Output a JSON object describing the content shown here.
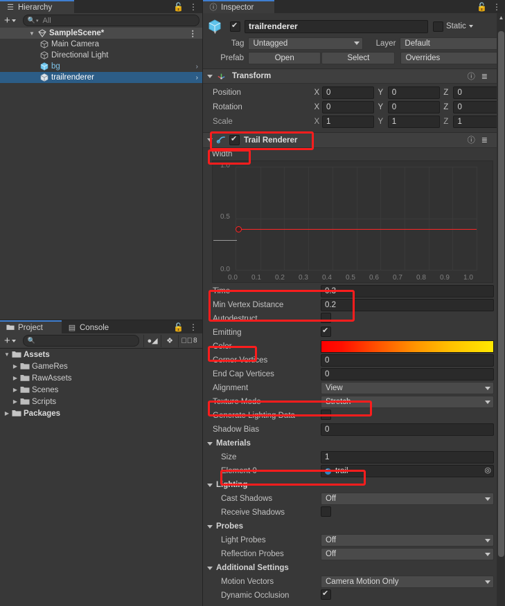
{
  "hierarchy": {
    "tab": "Hierarchy",
    "tab_icon": "hierarchy-icon",
    "lock_icon": "lock-icon",
    "menu_icon": "kebab-menu-icon",
    "add_label": "+",
    "search_placeholder": "All",
    "items": [
      {
        "label": "SampleScene*",
        "depth": 0,
        "icon": "scene-icon",
        "selected": false,
        "scene": true,
        "expanded": true,
        "prefab": false,
        "chevron": false
      },
      {
        "label": "Main Camera",
        "depth": 1,
        "icon": "gameobject-icon",
        "selected": false,
        "scene": false,
        "expanded": false,
        "prefab": false,
        "chevron": false
      },
      {
        "label": "Directional Light",
        "depth": 1,
        "icon": "gameobject-icon",
        "selected": false,
        "scene": false,
        "expanded": false,
        "prefab": false,
        "chevron": false
      },
      {
        "label": "bg",
        "depth": 1,
        "icon": "prefab-icon",
        "selected": false,
        "scene": false,
        "expanded": false,
        "prefab": true,
        "chevron": true
      },
      {
        "label": "trailrenderer",
        "depth": 1,
        "icon": "prefab-icon",
        "selected": true,
        "scene": false,
        "expanded": false,
        "prefab": true,
        "chevron": true
      }
    ]
  },
  "project": {
    "tabs": [
      {
        "label": "Project",
        "icon": "folder-icon",
        "active": true
      },
      {
        "label": "Console",
        "icon": "console-icon",
        "active": false
      }
    ],
    "lock_icon": "lock-icon",
    "menu_icon": "kebab-menu-icon",
    "add_label": "+",
    "search_placeholder": "",
    "toolbar_icons": [
      "avatar-filter-icon",
      "label-filter-icon",
      "visibility-icon"
    ],
    "visibility_count": "8",
    "tree": [
      {
        "label": "Assets",
        "depth": 0,
        "expanded": true,
        "bold": true
      },
      {
        "label": "GameRes",
        "depth": 1,
        "expanded": false,
        "bold": false
      },
      {
        "label": "RawAssets",
        "depth": 1,
        "expanded": false,
        "bold": false
      },
      {
        "label": "Scenes",
        "depth": 1,
        "expanded": false,
        "bold": false
      },
      {
        "label": "Scripts",
        "depth": 1,
        "expanded": false,
        "bold": false
      },
      {
        "label": "Packages",
        "depth": 0,
        "expanded": false,
        "bold": true
      }
    ]
  },
  "inspector": {
    "tab": "Inspector",
    "tab_icon": "info-icon",
    "lock_icon": "lock-icon",
    "menu_icon": "kebab-menu-icon",
    "gameobject": {
      "enabled": true,
      "name": "trailrenderer",
      "static_checked": false,
      "static_label": "Static",
      "tag_label": "Tag",
      "tag_value": "Untagged",
      "layer_label": "Layer",
      "layer_value": "Default",
      "prefab_label": "Prefab",
      "open_label": "Open",
      "select_label": "Select",
      "overrides_label": "Overrides"
    },
    "transform": {
      "title": "Transform",
      "icon": "transform-icon",
      "help_icon": "help-icon",
      "preset_icon": "preset-icon",
      "menu_icon": "kebab-menu-icon",
      "rows": [
        {
          "label": "Position",
          "x": "0",
          "y": "0",
          "z": "0"
        },
        {
          "label": "Rotation",
          "x": "0",
          "y": "0",
          "z": "0"
        },
        {
          "label": "Scale",
          "x": "1",
          "y": "1",
          "z": "1"
        }
      ],
      "axis_labels": [
        "X",
        "Y",
        "Z"
      ]
    },
    "trail_renderer": {
      "title": "Trail Renderer",
      "icon": "trail-renderer-icon",
      "enabled": true,
      "help_icon": "help-icon",
      "preset_icon": "preset-icon",
      "menu_icon": "kebab-menu-icon",
      "width_label": "Width",
      "properties": [
        {
          "label": "Time",
          "type": "text",
          "value": "0.3"
        },
        {
          "label": "Min Vertex Distance",
          "type": "text",
          "value": "0.2"
        },
        {
          "label": "Autodestruct",
          "type": "check",
          "value": false
        },
        {
          "label": "Emitting",
          "type": "check",
          "value": true
        },
        {
          "label": "Color",
          "type": "gradient",
          "value": ""
        },
        {
          "label": "Corner Vertices",
          "type": "text",
          "value": "0"
        },
        {
          "label": "End Cap Vertices",
          "type": "text",
          "value": "0"
        },
        {
          "label": "Alignment",
          "type": "dropdown",
          "value": "View"
        },
        {
          "label": "Texture Mode",
          "type": "dropdown",
          "value": "Stretch"
        },
        {
          "label": "Generate Lighting Data",
          "type": "check",
          "value": false
        },
        {
          "label": "Shadow Bias",
          "type": "text",
          "value": "0"
        }
      ],
      "materials": {
        "header": "Materials",
        "size_label": "Size",
        "size_value": "1",
        "element_label": "Element 0",
        "element_value": "trail",
        "picker_icon": "object-picker-icon"
      },
      "lighting": {
        "header": "Lighting",
        "rows": [
          {
            "label": "Cast Shadows",
            "type": "dropdown",
            "value": "Off"
          },
          {
            "label": "Receive Shadows",
            "type": "check",
            "value": false
          }
        ]
      },
      "probes": {
        "header": "Probes",
        "rows": [
          {
            "label": "Light Probes",
            "type": "dropdown",
            "value": "Off"
          },
          {
            "label": "Reflection Probes",
            "type": "dropdown",
            "value": "Off"
          }
        ]
      },
      "additional": {
        "header": "Additional Settings",
        "rows": [
          {
            "label": "Motion Vectors",
            "type": "dropdown",
            "value": "Camera Motion Only"
          },
          {
            "label": "Dynamic Occlusion",
            "type": "check",
            "value": true
          }
        ]
      }
    }
  },
  "chart_data": {
    "type": "line",
    "title": "Width",
    "x": [
      0.0,
      1.0
    ],
    "series": [
      {
        "name": "Width",
        "values": [
          0.4,
          0.4
        ],
        "color": "#ff2020"
      }
    ],
    "keyframes": [
      {
        "x": 0.0,
        "y": 0.4
      }
    ],
    "xlabel": "",
    "ylabel": "",
    "xlim": [
      0.0,
      1.0
    ],
    "ylim": [
      0.0,
      1.0
    ],
    "xticks": [
      "0.0",
      "0.1",
      "0.2",
      "0.3",
      "0.4",
      "0.5",
      "0.6",
      "0.7",
      "0.8",
      "0.9",
      "1.0"
    ],
    "yticks": [
      "1.0",
      "0.5",
      "0.0"
    ],
    "grid": true,
    "legend": "none"
  },
  "colors": {
    "accent": "#3f7fd1",
    "selection": "#2c5d87",
    "highlight": "#fb1d1d",
    "gradient_start": "#ff0000",
    "gradient_mid": "#ff9000",
    "gradient_end": "#ffe800",
    "panel_bg": "#383838",
    "curve_line": "#ff2020"
  }
}
